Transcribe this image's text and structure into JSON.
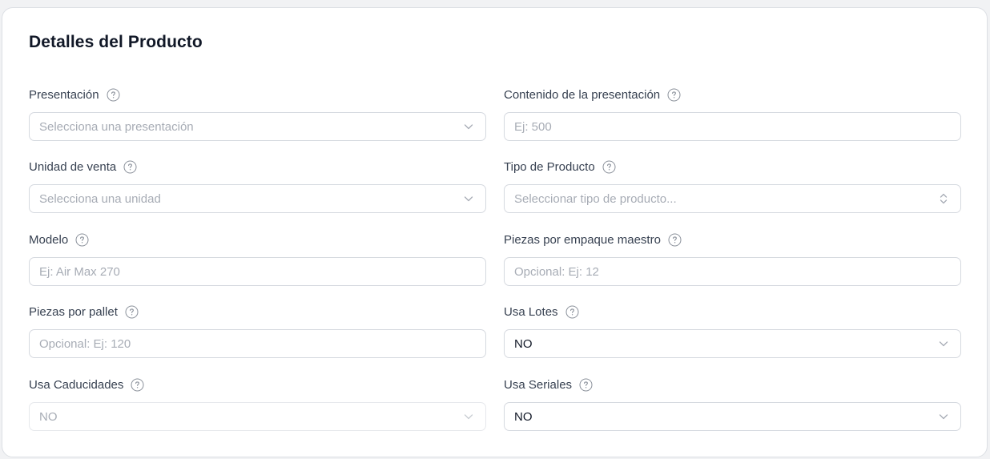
{
  "card": {
    "title": "Detalles del Producto"
  },
  "fields": {
    "presentacion": {
      "label": "Presentación",
      "placeholder": "Selecciona una presentación",
      "icon": "chevron-down-icon"
    },
    "contenido": {
      "label": "Contenido de la presentación",
      "placeholder": "Ej: 500"
    },
    "unidad_venta": {
      "label": "Unidad de venta",
      "placeholder": "Selecciona una unidad",
      "icon": "chevron-down-icon"
    },
    "tipo_producto": {
      "label": "Tipo de Producto",
      "placeholder": "Seleccionar tipo de producto...",
      "icon": "chevron-up-down-icon"
    },
    "modelo": {
      "label": "Modelo",
      "placeholder": "Ej: Air Max 270"
    },
    "piezas_empaque": {
      "label": "Piezas por empaque maestro",
      "placeholder": "Opcional: Ej: 12"
    },
    "piezas_pallet": {
      "label": "Piezas por pallet",
      "placeholder": "Opcional: Ej: 120"
    },
    "usa_lotes": {
      "label": "Usa Lotes",
      "value": "NO",
      "icon": "chevron-down-icon"
    },
    "usa_caducidades": {
      "label": "Usa Caducidades",
      "value": "NO",
      "disabled": true,
      "icon": "chevron-down-icon"
    },
    "usa_seriales": {
      "label": "Usa Seriales",
      "value": "NO",
      "icon": "chevron-down-icon"
    }
  },
  "help_icon": "help-circle-icon",
  "colors": {
    "background": "#f1f2f4",
    "card": "#ffffff",
    "border": "#d5d9df",
    "placeholder": "#a7acb5",
    "label": "#374151",
    "title": "#111827"
  }
}
